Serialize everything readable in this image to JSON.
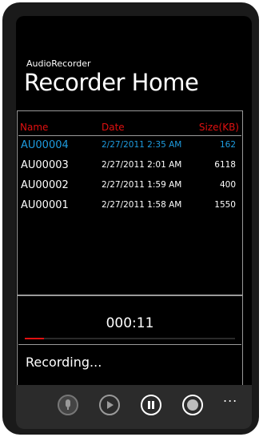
{
  "app": {
    "name": "AudioRecorder",
    "page_title": "Recorder Home"
  },
  "list": {
    "headers": {
      "name": "Name",
      "date": "Date",
      "size": "Size(KB)"
    },
    "rows": [
      {
        "name": "AU00004",
        "date": "2/27/2011 2:35 AM",
        "size": "162",
        "selected": true
      },
      {
        "name": "AU00003",
        "date": "2/27/2011 2:01 AM",
        "size": "6118",
        "selected": false
      },
      {
        "name": "AU00002",
        "date": "2/27/2011 1:59 AM",
        "size": "400",
        "selected": false
      },
      {
        "name": "AU00001",
        "date": "2/27/2011 1:58 AM",
        "size": "1550",
        "selected": false
      }
    ]
  },
  "recorder": {
    "timer": "000:11",
    "progress_fraction": 0.09,
    "status": "Recording..."
  },
  "appbar": {
    "buttons": [
      "microphone-icon",
      "play-icon",
      "pause-icon",
      "stop-icon"
    ],
    "more_label": "..."
  },
  "colors": {
    "accent_blue": "#1e9ce0",
    "header_red": "#e01010",
    "background": "#000000"
  }
}
